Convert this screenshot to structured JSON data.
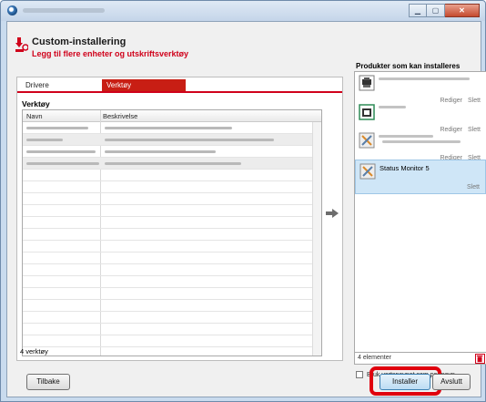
{
  "header": {
    "title": "Custom-installering",
    "subtitle": "Legg til flere enheter og utskriftsverktøy"
  },
  "tabs": [
    "Drivere",
    "Verktøy"
  ],
  "left": {
    "section_label": "Verktøy",
    "columns": [
      "Navn",
      "Beskrivelse"
    ],
    "count_label": "4 verktøy"
  },
  "right": {
    "title": "Produkter som kan installeres",
    "products": [
      {
        "name": "",
        "actions": [
          "Rediger",
          "Slett"
        ]
      },
      {
        "name": "",
        "actions": [
          "Rediger",
          "Slett"
        ]
      },
      {
        "name": "",
        "actions": [
          "Rediger",
          "Slett"
        ]
      },
      {
        "name": "Status Monitor 5",
        "actions": [
          "Slett"
        ]
      }
    ],
    "count": "4 elementer",
    "checkbox_label": "Bruk vertsnavnet som portnavn"
  },
  "buttons": {
    "back": "Tilbake",
    "install": "Installer",
    "exit": "Avslutt"
  },
  "colors": {
    "accent": "#d0021b",
    "highlight": "#e0000e",
    "selected_row": "#cfe6f7"
  }
}
